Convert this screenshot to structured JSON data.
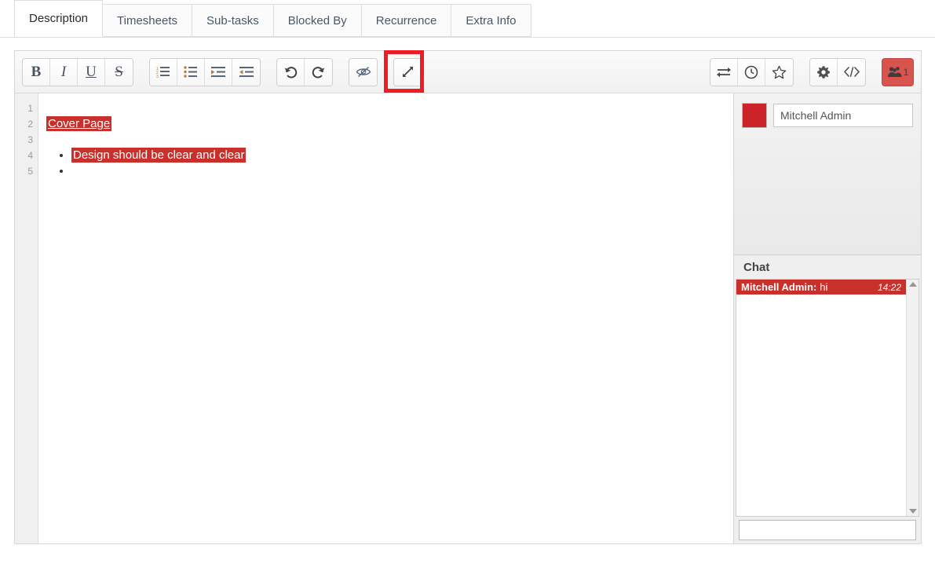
{
  "tabs": [
    {
      "label": "Description",
      "active": true
    },
    {
      "label": "Timesheets",
      "active": false
    },
    {
      "label": "Sub-tasks",
      "active": false
    },
    {
      "label": "Blocked By",
      "active": false
    },
    {
      "label": "Recurrence",
      "active": false
    },
    {
      "label": "Extra Info",
      "active": false
    }
  ],
  "toolbar": {
    "groups": [
      {
        "name": "text-format",
        "buttons": [
          {
            "name": "bold-button",
            "icon": "bold-icon",
            "glyph": "B"
          },
          {
            "name": "italic-button",
            "icon": "italic-icon",
            "glyph": "I"
          },
          {
            "name": "underline-button",
            "icon": "underline-icon",
            "glyph": "U"
          },
          {
            "name": "strikethrough-button",
            "icon": "strikethrough-icon",
            "glyph": "S"
          }
        ]
      },
      {
        "name": "list-format",
        "buttons": [
          {
            "name": "ordered-list-button",
            "icon": "ordered-list-icon"
          },
          {
            "name": "unordered-list-button",
            "icon": "unordered-list-icon"
          },
          {
            "name": "indent-button",
            "icon": "indent-icon"
          },
          {
            "name": "outdent-button",
            "icon": "outdent-icon"
          }
        ]
      },
      {
        "name": "history",
        "buttons": [
          {
            "name": "undo-button",
            "icon": "undo-icon"
          },
          {
            "name": "redo-button",
            "icon": "redo-icon"
          }
        ]
      },
      {
        "name": "preview",
        "buttons": [
          {
            "name": "hide-preview-button",
            "icon": "eye-slash-icon"
          }
        ]
      },
      {
        "name": "fullscreen",
        "highlighted": true,
        "buttons": [
          {
            "name": "expand-fullscreen-button",
            "icon": "expand-arrows-icon"
          }
        ]
      },
      {
        "name": "document-actions",
        "buttons": [
          {
            "name": "sync-button",
            "icon": "exchange-arrows-icon"
          },
          {
            "name": "history-clock-button",
            "icon": "clock-icon"
          },
          {
            "name": "favorite-button",
            "icon": "star-icon"
          }
        ]
      },
      {
        "name": "settings",
        "buttons": [
          {
            "name": "settings-button",
            "icon": "gear-icon"
          },
          {
            "name": "source-code-button",
            "icon": "code-brackets-icon"
          }
        ]
      }
    ],
    "collaborators_button": {
      "name": "collaborators-button",
      "icon": "users-icon",
      "count": "1",
      "color": "#d9534f"
    },
    "highlight_color": "#ee1c23"
  },
  "editor": {
    "line_numbers": [
      "1",
      "2",
      "3",
      "4",
      "5"
    ],
    "selection_color": "#c9302c",
    "content": {
      "heading": "Cover Page",
      "bullets": [
        "Design should be clear and clear",
        ""
      ]
    }
  },
  "side_panel": {
    "user": {
      "color": "#cc2229",
      "name": "Mitchell Admin"
    },
    "chat": {
      "title": "Chat",
      "messages": [
        {
          "author": "Mitchell Admin:",
          "text": "hi",
          "time": "14:22"
        }
      ],
      "input_value": "",
      "input_placeholder": ""
    }
  }
}
